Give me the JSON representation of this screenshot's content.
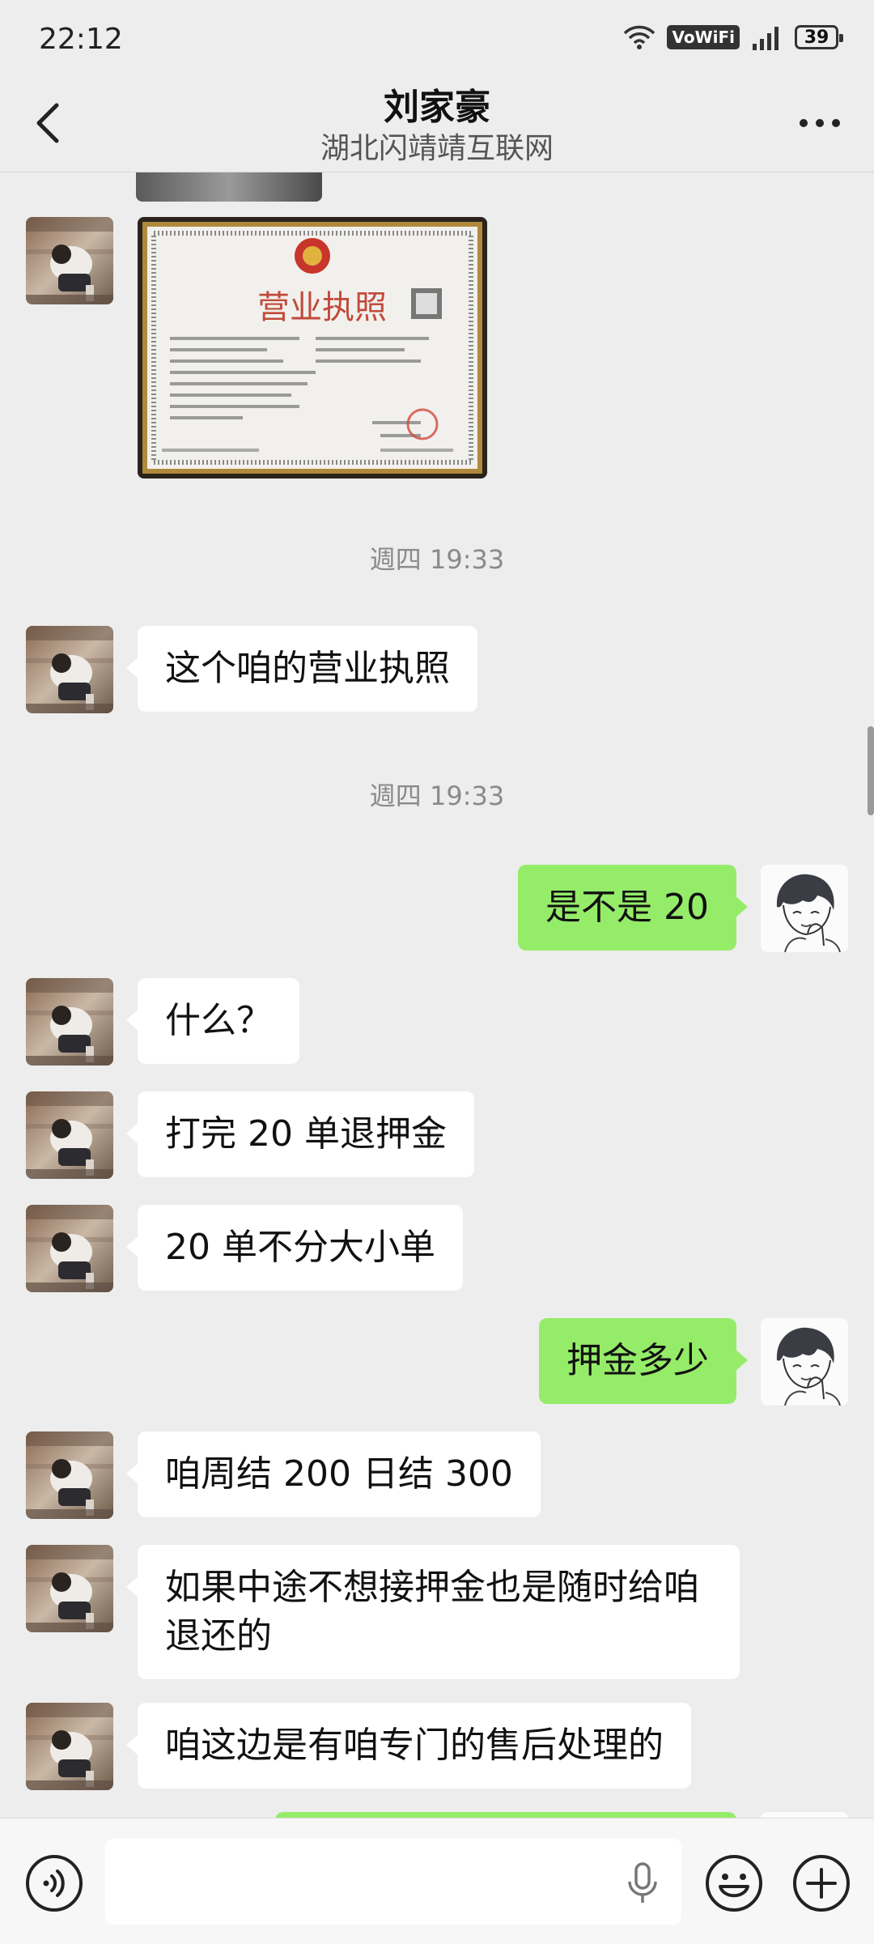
{
  "status_bar": {
    "time": "22:12",
    "network_label": "VoWiFi",
    "battery": "39"
  },
  "header": {
    "title": "刘家豪",
    "subtitle": "湖北闪靖靖互联网"
  },
  "license_image": {
    "heading": "营业执照"
  },
  "messages": [
    {
      "type": "image_partial",
      "side": "in"
    },
    {
      "type": "image",
      "side": "in",
      "content": "business-license-photo"
    },
    {
      "type": "timestamp",
      "text": "週四 19:33"
    },
    {
      "type": "text",
      "side": "in",
      "text": "这个咱的营业执照"
    },
    {
      "type": "timestamp",
      "text": "週四 19:33"
    },
    {
      "type": "text",
      "side": "out",
      "text": "是不是 20"
    },
    {
      "type": "text",
      "side": "in",
      "text": "什么？"
    },
    {
      "type": "text",
      "side": "in",
      "text": "打完 20 单退押金"
    },
    {
      "type": "text",
      "side": "in",
      "text": "20 单不分大小单"
    },
    {
      "type": "text",
      "side": "out",
      "text": "押金多少"
    },
    {
      "type": "text",
      "side": "in",
      "text": "咱周结 200 日结 300"
    },
    {
      "type": "text",
      "side": "in",
      "text": "如果中途不想接押金也是随时给咱退还的"
    },
    {
      "type": "text",
      "side": "in",
      "text": "咱这边是有咱专门的售后处理的"
    },
    {
      "type": "text_partial",
      "side": "out"
    }
  ],
  "colors": {
    "background": "#ededed",
    "bubble_in": "#ffffff",
    "bubble_out": "#95ec69",
    "input_bar": "#f7f7f7"
  },
  "icons": {
    "back": "chevron-left-icon",
    "more": "more-dots-icon",
    "voice": "voice-icon",
    "mic": "mic-icon",
    "emoji": "emoji-icon",
    "add": "plus-icon"
  }
}
